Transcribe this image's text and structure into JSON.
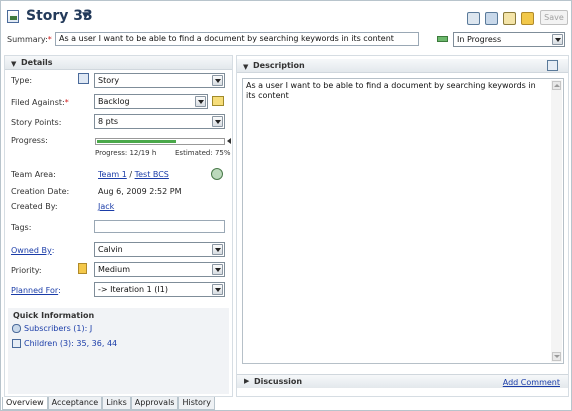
{
  "header": {
    "title": "Story 33",
    "save_label": "Save",
    "summary_label": "Summary:",
    "summary_required": "*",
    "summary_value": "As a user I want to be able to find a document by searching keywords in its content",
    "state_value": "In Progress"
  },
  "details": {
    "section_title": "Details",
    "type_label": "Type:",
    "type_value": "Story",
    "filed_against_label": "Filed Against:",
    "filed_against_required": "*",
    "filed_against_value": "Backlog",
    "story_points_label": "Story Points:",
    "story_points_value": "8 pts",
    "progress_label": "Progress:",
    "progress_fraction": 0.63,
    "progress_text": "Progress: 12/19 h",
    "estimated_text": "Estimated: 75%",
    "team_area_label": "Team Area:",
    "team_area_value": "Team 1",
    "team_area_sep": "/",
    "team_area_parent": "Test BCS",
    "creation_date_label": "Creation Date:",
    "creation_date_value": "Aug 6, 2009 2:52 PM",
    "created_by_label": "Created By:",
    "created_by_value": "Jack",
    "tags_label": "Tags:",
    "tags_value": "",
    "owned_by_label": "Owned By",
    "owned_by_colon": ":",
    "owned_by_value": "Calvin",
    "priority_label": "Priority:",
    "priority_value": "Medium",
    "planned_for_label": "Planned For",
    "planned_for_colon": ":",
    "planned_for_value": "-> Iteration 1 (I1)"
  },
  "quick_info": {
    "title": "Quick Information",
    "subscribers": "Subscribers (1):",
    "subscribers_value": "J",
    "children": "Children (3):",
    "children_value": "35, 36, 44"
  },
  "description": {
    "section_title": "Description",
    "text": "As a user I want to be able to find a document by searching keywords in its content"
  },
  "discussion": {
    "section_title": "Discussion",
    "add_comment": "Add Comment"
  },
  "tabs": [
    "Overview",
    "Acceptance",
    "Links",
    "Approvals",
    "History"
  ],
  "colors": {
    "accent_link": "#1a3ca8",
    "progress_fill": "#4aa84a",
    "required": "#d02020"
  }
}
